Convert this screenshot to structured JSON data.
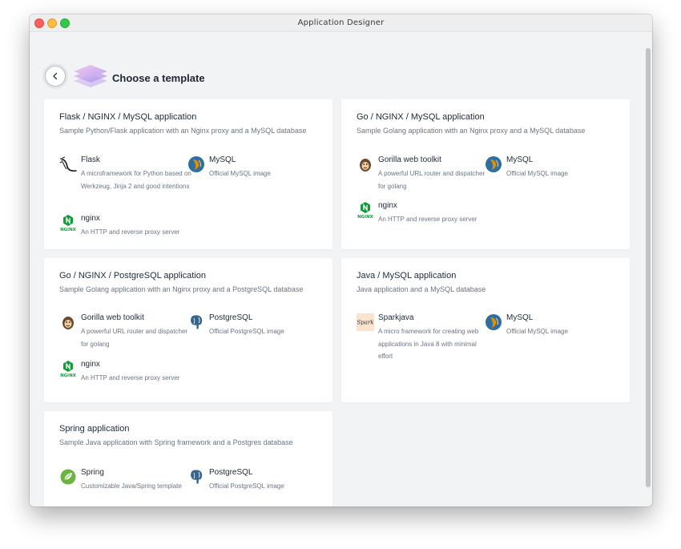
{
  "window": {
    "title": "Application Designer"
  },
  "header": {
    "title": "Choose a template"
  },
  "icons": {
    "back": "chevron-left-icon",
    "layers": "layers-icon",
    "flask": "flask-icon",
    "mysql": "mysql-icon",
    "nginx": "nginx-icon",
    "gorilla": "gorilla-icon",
    "postgres": "postgresql-icon",
    "spark": "sparkjava-icon",
    "spring": "spring-icon"
  },
  "colors": {
    "background": "#f2f3f5",
    "card": "#ffffff",
    "title_text": "#1f2a3a",
    "muted_text": "#6b7583",
    "nginx_green": "#159a3c",
    "spring_green": "#6db33f",
    "postgres_blue": "#336791",
    "mysql_orange": "#e48e00"
  },
  "templates": [
    {
      "title": "Flask / NGINX / MySQL application",
      "description": "Sample Python/Flask application with an Nginx proxy and a MySQL database",
      "services": [
        {
          "name": "Flask",
          "description": "A microframework for Python based on Werkzeug, Jinja 2 and good intentions"
        },
        {
          "name": "MySQL",
          "description": "Official MySQL image"
        },
        {
          "name": "nginx",
          "description": "An HTTP and reverse proxy server"
        }
      ]
    },
    {
      "title": "Go / NGINX / MySQL application",
      "description": "Sample Golang application with an Nginx proxy and a MySQL database",
      "services": [
        {
          "name": "Gorilla web toolkit",
          "description": "A powerful URL router and dispatcher for golang"
        },
        {
          "name": "MySQL",
          "description": "Official MySQL image"
        },
        {
          "name": "nginx",
          "description": "An HTTP and reverse proxy server"
        }
      ]
    },
    {
      "title": "Go / NGINX / PostgreSQL application",
      "description": "Sample Golang application with an Nginx proxy and a PostgreSQL database",
      "services": [
        {
          "name": "Gorilla web toolkit",
          "description": "A powerful URL router and dispatcher for golang"
        },
        {
          "name": "PostgreSQL",
          "description": "Official PostgreSQL image"
        },
        {
          "name": "nginx",
          "description": "An HTTP and reverse proxy server"
        }
      ]
    },
    {
      "title": "Java / MySQL application",
      "description": "Java application and a MySQL database",
      "services": [
        {
          "name": "Sparkjava",
          "description": "A micro framework for creating web applications in Java 8 with minimal effort"
        },
        {
          "name": "MySQL",
          "description": "Official MySQL image"
        }
      ]
    },
    {
      "title": "Spring application",
      "description": "Sample Java application with Spring framework and a Postgres database",
      "services": [
        {
          "name": "Spring",
          "description": "Customizable Java/Spring template"
        },
        {
          "name": "PostgreSQL",
          "description": "Official PostgreSQL image"
        }
      ]
    }
  ]
}
